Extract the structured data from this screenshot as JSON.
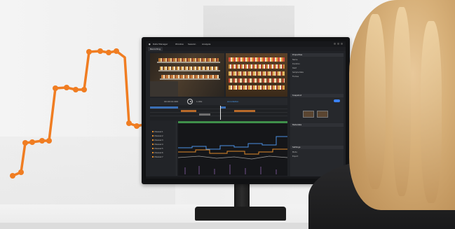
{
  "scene": {
    "description_colors": {
      "accent_orange": "#f07d22",
      "monitor_bezel": "#111214",
      "app_background": "#202226",
      "hair": "#d7b079",
      "sweater": "#222224"
    }
  },
  "app": {
    "window_title": "Data Manager",
    "menu_1": "Window",
    "menu_2": "Session",
    "menu_3": "Analysis",
    "active_tab": "Recording",
    "timecode": "00:00:01:000",
    "speed_label": "1.00x",
    "annotation_label": "Annotation",
    "side_items": [
      "Channel 1",
      "Channel 2",
      "Channel 3",
      "Channel 4",
      "Channel 5",
      "Channel 6",
      "Channel 7"
    ],
    "panel": {
      "header_1": "Properties",
      "header_2": "Snapshot",
      "header_3": "Metadata",
      "header_4": "Settings",
      "rows": [
        "Name",
        "Duration",
        "Start",
        "Sample Rate",
        "Frames"
      ],
      "settings_rows": [
        "Mode",
        "Export"
      ]
    }
  }
}
